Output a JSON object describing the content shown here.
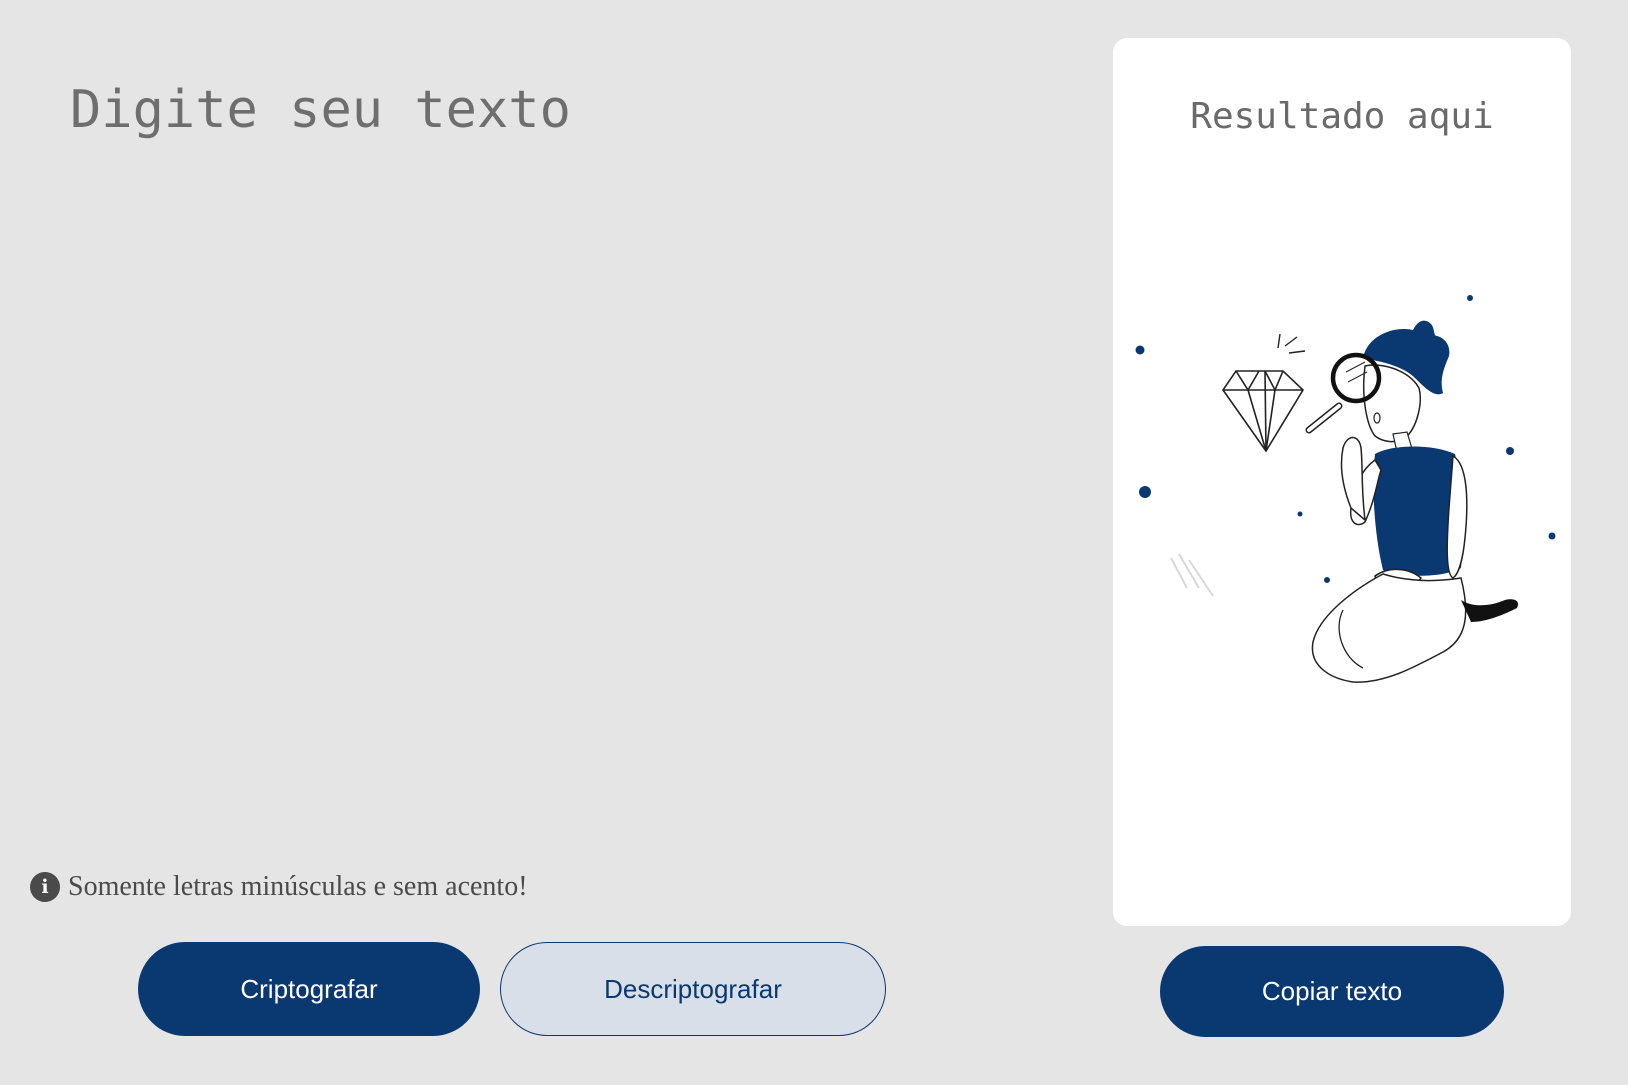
{
  "input": {
    "placeholder": "Digite seu texto",
    "value": ""
  },
  "info": {
    "icon": "info-icon",
    "glyph": "i",
    "text": "Somente letras minúsculas e sem acento!"
  },
  "buttons": {
    "encrypt_label": "Criptografar",
    "decrypt_label": "Descriptografar",
    "copy_label": "Copiar texto"
  },
  "result": {
    "title": "Resultado aqui",
    "illustration": "person-with-magnifying-glass-and-diamond"
  },
  "colors": {
    "background": "#e5e5e5",
    "primary": "#0a3871",
    "secondary_bg": "#d8dfe8",
    "panel": "#ffffff",
    "text_muted": "#6e6e6e"
  }
}
